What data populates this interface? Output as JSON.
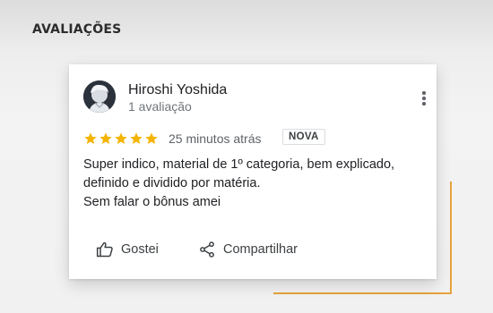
{
  "section": {
    "heading": "AVALIAÇÕES"
  },
  "review": {
    "reviewer_name": "Hiroshi Yoshida",
    "review_count": "1 avaliação",
    "rating": 5,
    "rating_max": 5,
    "time": "25 minutos atrás",
    "badge": "NOVA",
    "text_lines": [
      "Super indico, material de 1º categoria, bem explicado,",
      "definido e dividido por matéria.",
      "Sem falar o bônus amei"
    ],
    "actions": {
      "like_label": "Gostei",
      "share_label": "Compartilhar"
    }
  },
  "colors": {
    "star": "#f4b400",
    "accent_line": "#e6a23c",
    "card_background": "#ffffff"
  },
  "icons": {
    "more": "more-vert-icon",
    "star": "star-icon",
    "like": "thumb-up-icon",
    "share": "share-icon"
  }
}
